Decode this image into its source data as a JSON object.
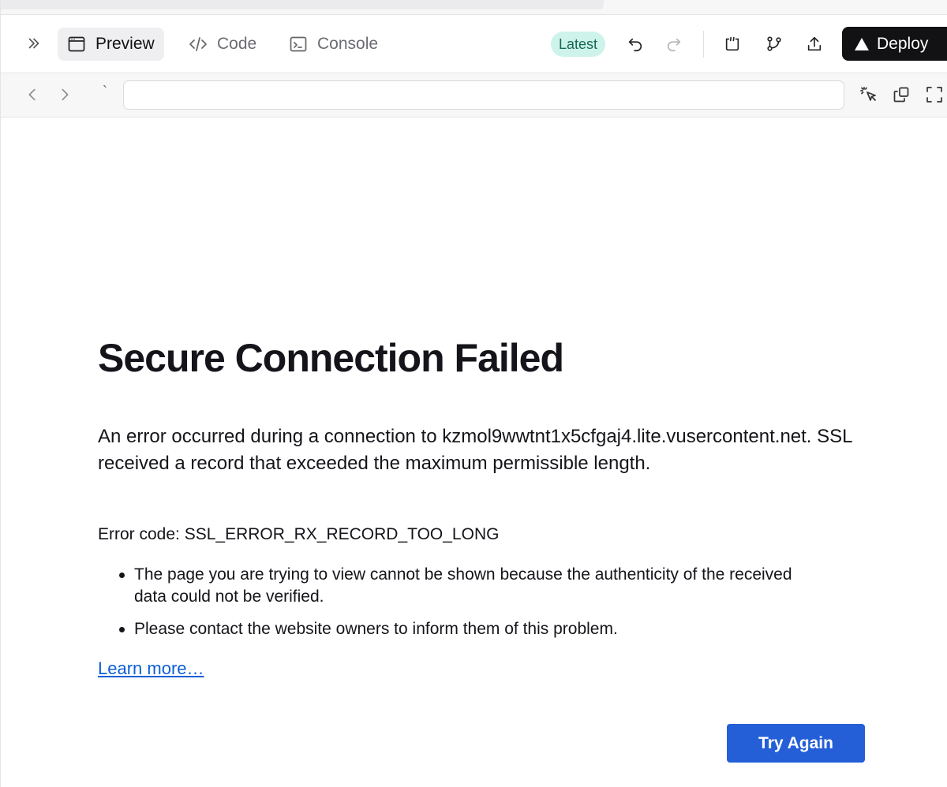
{
  "toolbar": {
    "tabs": [
      {
        "label": "Preview",
        "icon": "browser-window-icon",
        "active": true
      },
      {
        "label": "Code",
        "icon": "code-brackets-icon",
        "active": false
      },
      {
        "label": "Console",
        "icon": "terminal-icon",
        "active": false
      }
    ],
    "badge": "Latest",
    "deploy_label": "Deploy"
  },
  "addressbar": {
    "url_value": "",
    "tick": "`"
  },
  "error": {
    "title": "Secure Connection Failed",
    "message": "An error occurred during a connection to kzmol9wwtnt1x5cfgaj4.lite.vusercontent.net. SSL received a record that exceeded the maximum permissible length.",
    "code_line": "Error code: SSL_ERROR_RX_RECORD_TOO_LONG",
    "bullets": [
      "The page you are trying to view cannot be shown because the authenticity of the received data could not be verified.",
      "Please contact the website owners to inform them of this problem."
    ],
    "learn_more": "Learn more…",
    "try_again": "Try Again"
  },
  "colors": {
    "badge_bg": "#cdf3ea",
    "badge_text": "#17694f",
    "deploy_bg": "#121214",
    "primary_button": "#245fd8",
    "link": "#0b5fd6"
  }
}
